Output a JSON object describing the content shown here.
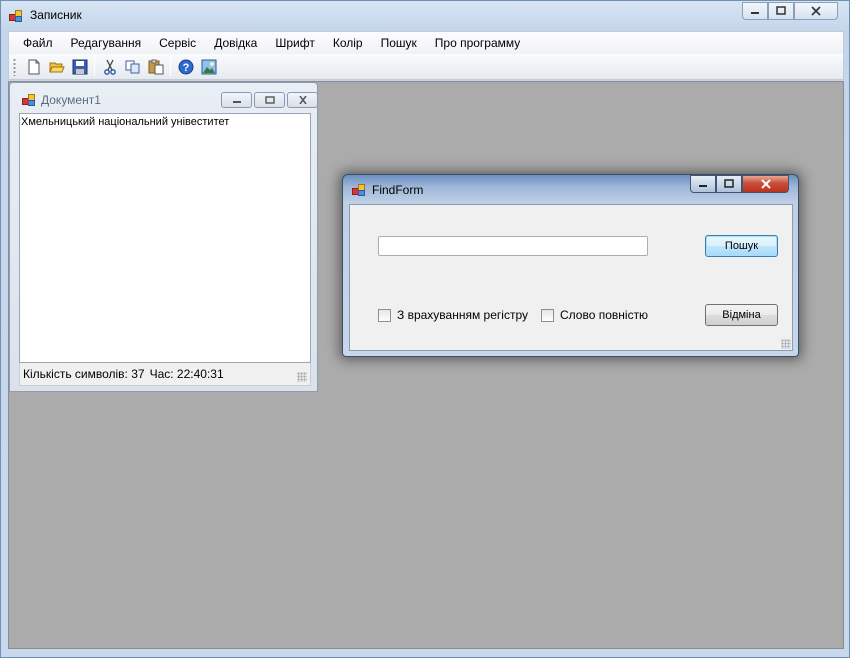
{
  "main_window": {
    "title": "Записник"
  },
  "menu": {
    "items": [
      "Файл",
      "Редагування",
      "Сервіс",
      "Довідка",
      "Шрифт",
      "Колір",
      "Пошук",
      "Про программу"
    ]
  },
  "toolbar": {
    "buttons": [
      "new-icon",
      "open-icon",
      "save-icon",
      "cut-icon",
      "copy-icon",
      "paste-icon",
      "help-icon",
      "image-icon"
    ]
  },
  "document_window": {
    "title": "Документ1",
    "text": "Хмельницький національний унівеститет",
    "status": {
      "char_count": "Кількість символів: 37",
      "time": "Час: 22:40:31"
    }
  },
  "find_form": {
    "title": "FindForm",
    "search_value": "",
    "search_button": "Пошук",
    "cancel_button": "Відміна",
    "match_case_label": "З врахуванням регістру",
    "whole_word_label": "Слово повністю"
  },
  "colors": {
    "mdi_background": "#ababab",
    "title_bar": "#c4d6ec",
    "close_button": "#c9503b"
  }
}
